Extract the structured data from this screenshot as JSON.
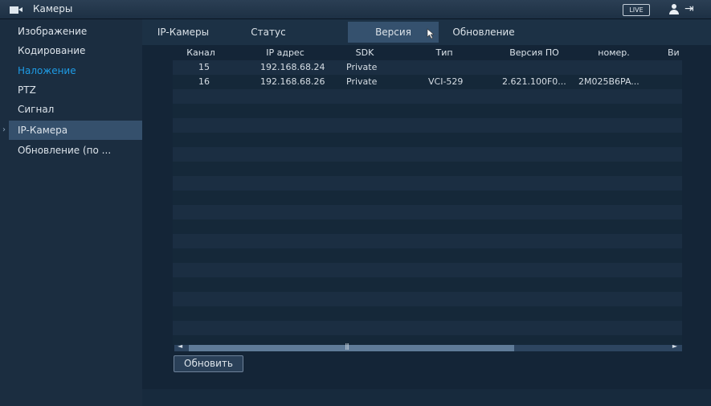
{
  "app": {
    "title": "Камеры",
    "live_badge": "LIVE"
  },
  "sidebar": {
    "items": [
      {
        "label": "Изображение"
      },
      {
        "label": "Кодирование"
      },
      {
        "label": "Наложение"
      },
      {
        "label": "PTZ"
      },
      {
        "label": "Сигнал"
      },
      {
        "label": "IP-Камера"
      },
      {
        "label": "Обновление (по ..."
      }
    ],
    "selected_arrow": "›"
  },
  "tabs": [
    {
      "label": "IP-Камеры"
    },
    {
      "label": "Статус"
    },
    {
      "label": "Версия"
    },
    {
      "label": "Обновление"
    }
  ],
  "table": {
    "columns": [
      "Канал",
      "IP адрес",
      "SDK",
      "Тип",
      "Версия ПО",
      "номер.",
      "Ви"
    ],
    "rows": [
      [
        "15",
        "192.168.68.24",
        "Private",
        "",
        "",
        "",
        ""
      ],
      [
        "16",
        "192.168.68.26",
        "Private",
        "VCI-529",
        "2.621.100F0...",
        "2M025B6PA...",
        ""
      ]
    ]
  },
  "scrollbar": {
    "left_arrow": "◄",
    "right_arrow": "►",
    "grip": "|||"
  },
  "buttons": {
    "refresh": "Обновить"
  },
  "colors": {
    "accent_blue": "#1e9ce6",
    "selected_bg": "#35506c"
  }
}
